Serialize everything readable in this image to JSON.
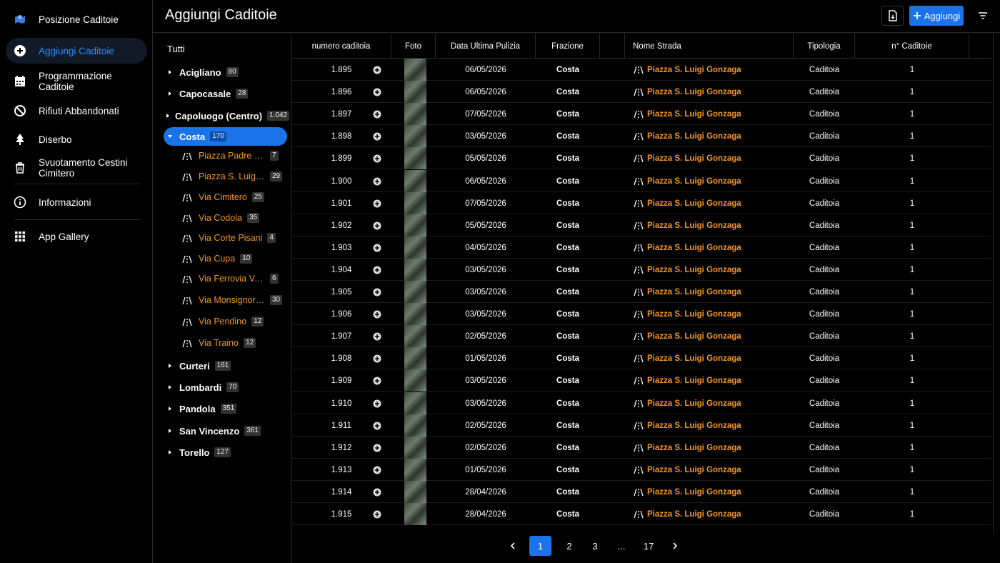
{
  "nav": {
    "items": [
      {
        "label": "Posizione Caditoie",
        "icon": "map-pin-icon",
        "active": false
      },
      {
        "label": "Aggiungi Caditoie",
        "icon": "add-circle-icon",
        "active": true
      },
      {
        "label": "Programmazione Caditoie",
        "icon": "calendar-icon",
        "active": false
      },
      {
        "label": "Rifiuti Abbandonati",
        "icon": "block-icon",
        "active": false
      },
      {
        "label": "Diserbo",
        "icon": "tree-icon",
        "active": false
      },
      {
        "label": "Svuotamento Cestini Cimitero",
        "icon": "trash-icon",
        "active": false
      },
      {
        "label": "Informazioni",
        "icon": "info-icon",
        "active": false
      },
      {
        "label": "App Gallery",
        "icon": "grid-icon",
        "active": false
      }
    ]
  },
  "header": {
    "title": "Aggiungi Caditoie",
    "add_label": "Aggiungi"
  },
  "tree": {
    "all_label": "Tutti",
    "groups_before": [
      {
        "label": "Acigliano",
        "count": "80"
      },
      {
        "label": "Capocasale",
        "count": "28"
      },
      {
        "label": "Capoluogo (Centro)",
        "count": "1.042"
      }
    ],
    "selected": {
      "label": "Costa",
      "count": "170"
    },
    "leaves": [
      {
        "label": "Piazza Padre Bonaventura",
        "count": "7"
      },
      {
        "label": "Piazza S. Luigi Gonzaga",
        "count": "29"
      },
      {
        "label": "Via Cimitero",
        "count": "25"
      },
      {
        "label": "Via Codola",
        "count": "35"
      },
      {
        "label": "Via Corte Pisani",
        "count": "4"
      },
      {
        "label": "Via Cupa",
        "count": "10"
      },
      {
        "label": "Via Ferrovia Valle",
        "count": "6"
      },
      {
        "label": "Via Monsignor Costa",
        "count": "30"
      },
      {
        "label": "Via Pendino",
        "count": "12"
      },
      {
        "label": "Via Traino",
        "count": "12"
      }
    ],
    "groups_after": [
      {
        "label": "Curteri",
        "count": "161"
      },
      {
        "label": "Lombardi",
        "count": "70"
      },
      {
        "label": "Pandola",
        "count": "351"
      },
      {
        "label": "San Vincenzo",
        "count": "361"
      },
      {
        "label": "Torello",
        "count": "127"
      }
    ]
  },
  "table": {
    "headers": [
      "numero caditoia",
      "Foto",
      "Data Ultima Pulizia",
      "Frazione",
      "Nome Strada",
      "Tipologia",
      "n° Caditoie"
    ],
    "rows": [
      {
        "num": "1.895",
        "date": "06/05/2026",
        "frazione": "Costa",
        "strada": "Piazza S. Luigi Gonzaga",
        "tipologia": "Caditoia",
        "qty": "1"
      },
      {
        "num": "1.896",
        "date": "06/05/2026",
        "frazione": "Costa",
        "strada": "Piazza S. Luigi Gonzaga",
        "tipologia": "Caditoia",
        "qty": "1"
      },
      {
        "num": "1.897",
        "date": "07/05/2026",
        "frazione": "Costa",
        "strada": "Piazza S. Luigi Gonzaga",
        "tipologia": "Caditoia",
        "qty": "1"
      },
      {
        "num": "1.898",
        "date": "03/05/2026",
        "frazione": "Costa",
        "strada": "Piazza S. Luigi Gonzaga",
        "tipologia": "Caditoia",
        "qty": "1"
      },
      {
        "num": "1.899",
        "date": "05/05/2026",
        "frazione": "Costa",
        "strada": "Piazza S. Luigi Gonzaga",
        "tipologia": "Caditoia",
        "qty": "1"
      },
      {
        "num": "1.900",
        "date": "06/05/2026",
        "frazione": "Costa",
        "strada": "Piazza S. Luigi Gonzaga",
        "tipologia": "Caditoia",
        "qty": "1"
      },
      {
        "num": "1.901",
        "date": "07/05/2026",
        "frazione": "Costa",
        "strada": "Piazza S. Luigi Gonzaga",
        "tipologia": "Caditoia",
        "qty": "1"
      },
      {
        "num": "1.902",
        "date": "05/05/2026",
        "frazione": "Costa",
        "strada": "Piazza S. Luigi Gonzaga",
        "tipologia": "Caditoia",
        "qty": "1"
      },
      {
        "num": "1.903",
        "date": "04/05/2026",
        "frazione": "Costa",
        "strada": "Piazza S. Luigi Gonzaga",
        "tipologia": "Caditoia",
        "qty": "1"
      },
      {
        "num": "1.904",
        "date": "03/05/2026",
        "frazione": "Costa",
        "strada": "Piazza S. Luigi Gonzaga",
        "tipologia": "Caditoia",
        "qty": "1"
      },
      {
        "num": "1.905",
        "date": "03/05/2026",
        "frazione": "Costa",
        "strada": "Piazza S. Luigi Gonzaga",
        "tipologia": "Caditoia",
        "qty": "1"
      },
      {
        "num": "1.906",
        "date": "03/05/2026",
        "frazione": "Costa",
        "strada": "Piazza S. Luigi Gonzaga",
        "tipologia": "Caditoia",
        "qty": "1"
      },
      {
        "num": "1.907",
        "date": "02/05/2026",
        "frazione": "Costa",
        "strada": "Piazza S. Luigi Gonzaga",
        "tipologia": "Caditoia",
        "qty": "1"
      },
      {
        "num": "1.908",
        "date": "01/05/2026",
        "frazione": "Costa",
        "strada": "Piazza S. Luigi Gonzaga",
        "tipologia": "Caditoia",
        "qty": "1"
      },
      {
        "num": "1.909",
        "date": "03/05/2026",
        "frazione": "Costa",
        "strada": "Piazza S. Luigi Gonzaga",
        "tipologia": "Caditoia",
        "qty": "1"
      },
      {
        "num": "1.910",
        "date": "03/05/2026",
        "frazione": "Costa",
        "strada": "Piazza S. Luigi Gonzaga",
        "tipologia": "Caditoia",
        "qty": "1"
      },
      {
        "num": "1.911",
        "date": "02/05/2026",
        "frazione": "Costa",
        "strada": "Piazza S. Luigi Gonzaga",
        "tipologia": "Caditoia",
        "qty": "1"
      },
      {
        "num": "1.912",
        "date": "02/05/2026",
        "frazione": "Costa",
        "strada": "Piazza S. Luigi Gonzaga",
        "tipologia": "Caditoia",
        "qty": "1"
      },
      {
        "num": "1.913",
        "date": "01/05/2026",
        "frazione": "Costa",
        "strada": "Piazza S. Luigi Gonzaga",
        "tipologia": "Caditoia",
        "qty": "1"
      },
      {
        "num": "1.914",
        "date": "28/04/2026",
        "frazione": "Costa",
        "strada": "Piazza S. Luigi Gonzaga",
        "tipologia": "Caditoia",
        "qty": "1"
      },
      {
        "num": "1.915",
        "date": "28/04/2026",
        "frazione": "Costa",
        "strada": "Piazza S. Luigi Gonzaga",
        "tipologia": "Caditoia",
        "qty": "1"
      }
    ]
  },
  "pagination": {
    "pages": [
      "1",
      "2",
      "3",
      "...",
      "17"
    ],
    "current": "1"
  },
  "colors": {
    "accent": "#1a73e8",
    "street": "#f29722",
    "background": "#000000"
  }
}
